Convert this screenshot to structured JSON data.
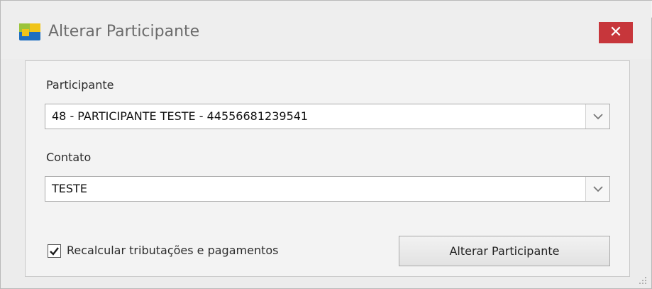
{
  "window": {
    "title": "Alterar Participante",
    "close_glyph": "✕",
    "icon": "app-logo-icon"
  },
  "participante": {
    "label": "Participante",
    "value": "48 - PARTICIPANTE TESTE - 44556681239541"
  },
  "contato": {
    "label": "Contato",
    "value": "TESTE"
  },
  "options": {
    "recalcular_label": "Recalcular tributações e pagamentos",
    "recalcular_checked": true
  },
  "actions": {
    "submit_label": "Alterar Participante"
  },
  "colors": {
    "close_button": "#c7363b",
    "icon_green": "#9bc43a",
    "icon_yellow": "#f0c419",
    "icon_blue": "#1e6fc0"
  }
}
